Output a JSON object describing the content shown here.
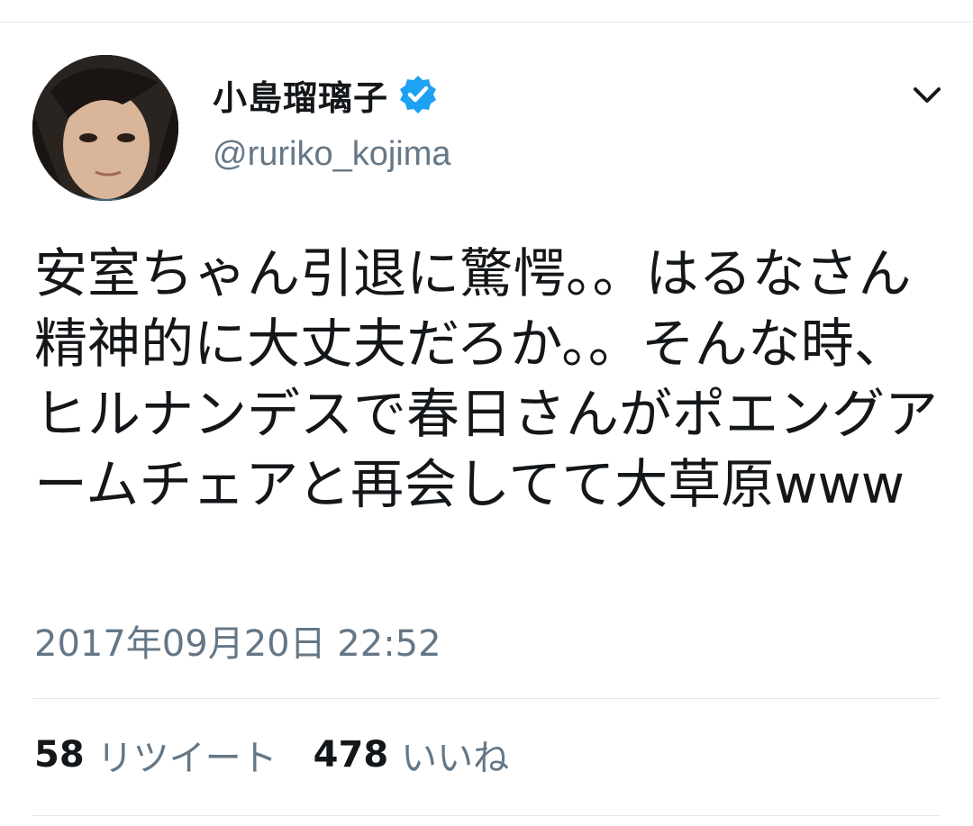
{
  "user": {
    "display_name": "小島瑠璃子",
    "handle": "@ruriko_kojima",
    "verified": true,
    "avatar_icon": "profile-photo"
  },
  "tweet": {
    "text": "安室ちゃん引退に驚愕。。はるなさん精神的に大丈夫だろか。。そんな時、ヒルナンデスで春日さんがポエングアームチェアと再会してて大草原www",
    "timestamp": "2017年09月20日 22:52"
  },
  "stats": {
    "retweet_count": "58",
    "retweet_label": "リツイート",
    "like_count": "478",
    "like_label": "いいね"
  },
  "icons": {
    "verified": "verified-badge-icon",
    "menu": "chevron-down-icon"
  },
  "colors": {
    "text_primary": "#14171a",
    "text_secondary": "#657786",
    "verified_blue": "#1da1f2",
    "divider": "#e1e8ed"
  }
}
